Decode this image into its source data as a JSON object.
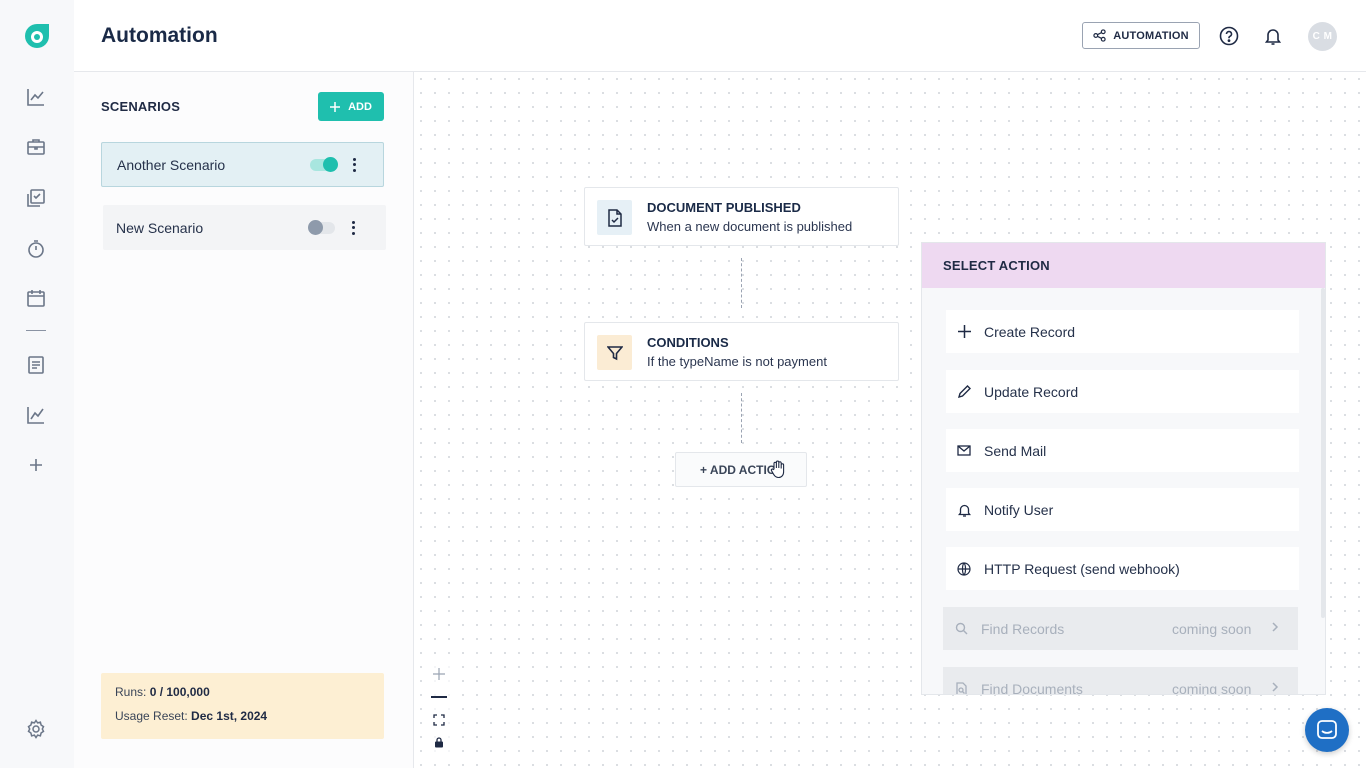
{
  "app": {
    "logo_letter": "d",
    "brand_color": "#1fbfae"
  },
  "header": {
    "title": "Automation",
    "automation_button": "AUTOMATION",
    "avatar_initials": "C M"
  },
  "rail": {
    "items": [
      "dashboard-chart-icon",
      "briefcase-icon",
      "checklist-icon",
      "timer-icon",
      "calendar-icon",
      "document-icon",
      "analytics-icon",
      "plus-icon"
    ],
    "bottom": "gear-icon"
  },
  "scenarios": {
    "title": "SCENARIOS",
    "add_label": "ADD",
    "items": [
      {
        "name": "Another Scenario",
        "enabled": true,
        "active": true
      },
      {
        "name": "New Scenario",
        "enabled": false,
        "active": false
      }
    ],
    "usage": {
      "runs_label": "Runs:",
      "runs_value": "0 / 100,000",
      "reset_label": "Usage Reset:",
      "reset_value": "Dec 1st, 2024"
    }
  },
  "flow": {
    "trigger": {
      "title": "DOCUMENT PUBLISHED",
      "subtitle": "When a new document is published"
    },
    "conditions": {
      "title": "CONDITIONS",
      "subtitle": "If the typeName is not payment"
    },
    "add_action": "+ ADD ACTIO"
  },
  "select_action": {
    "title": "SELECT ACTION",
    "items": [
      {
        "label": "Create Record",
        "icon": "plus-icon"
      },
      {
        "label": "Update Record",
        "icon": "pencil-icon"
      },
      {
        "label": "Send Mail",
        "icon": "mail-icon"
      },
      {
        "label": "Notify User",
        "icon": "bell-icon"
      },
      {
        "label": "HTTP Request (send webhook)",
        "icon": "globe-icon"
      }
    ],
    "disabled_items": [
      {
        "label": "Find Records",
        "badge": "coming soon",
        "icon": "search-icon"
      },
      {
        "label": "Find Documents",
        "badge": "coming soon",
        "icon": "find-document-icon"
      }
    ]
  }
}
